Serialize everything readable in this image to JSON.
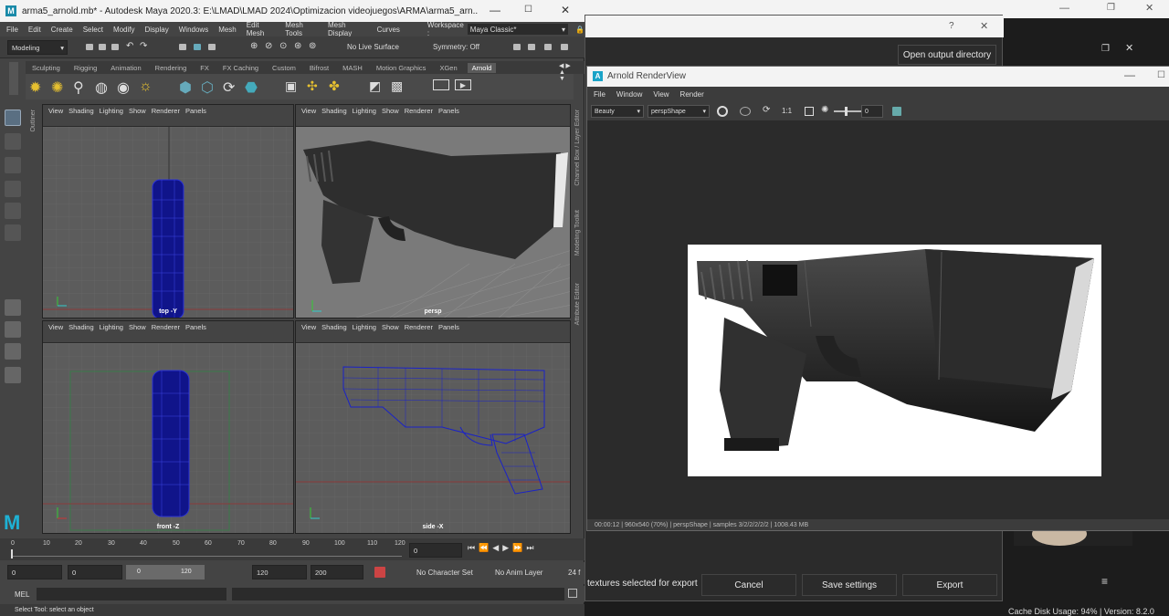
{
  "maya": {
    "title": "arma5_arnold.mb* - Autodesk Maya 2020.3: E:\\LMAD\\LMAD 2024\\Optimizacion videojuegos\\ARMA\\arma5_arn...",
    "menu": [
      "File",
      "Edit",
      "Create",
      "Select",
      "Modify",
      "Display",
      "Windows",
      "Mesh",
      "Edit Mesh",
      "Mesh Tools",
      "Mesh Display",
      "Curves"
    ],
    "workspace_label": "Workspace :",
    "workspace_value": "Maya Classic*",
    "menuset": "Modeling",
    "live_surface": "No Live Surface",
    "symmetry": "Symmetry: Off",
    "shelf_tabs": [
      "Sculpting",
      "Rigging",
      "Animation",
      "Rendering",
      "FX",
      "FX Caching",
      "Custom",
      "Bifrost",
      "MASH",
      "Motion Graphics",
      "XGen",
      "Arnold"
    ],
    "active_shelf": "Arnold",
    "viewports": [
      {
        "menu": [
          "View",
          "Shading",
          "Lighting",
          "Show",
          "Renderer",
          "Panels"
        ],
        "label": "top -Y"
      },
      {
        "menu": [
          "View",
          "Shading",
          "Lighting",
          "Show",
          "Renderer",
          "Panels"
        ],
        "label": "persp"
      },
      {
        "menu": [
          "View",
          "Shading",
          "Lighting",
          "Show",
          "Renderer",
          "Panels"
        ],
        "label": "front -Z"
      },
      {
        "menu": [
          "View",
          "Shading",
          "Lighting",
          "Show",
          "Renderer",
          "Panels"
        ],
        "label": "side -X"
      }
    ],
    "side_labels": [
      "Outliner",
      "Channel Box / Layer Editor",
      "Modeling Toolkit",
      "Attribute Editor"
    ],
    "timeline_ticks": [
      "0",
      "10",
      "20",
      "30",
      "40",
      "50",
      "60",
      "70",
      "80",
      "90",
      "100",
      "110",
      "120"
    ],
    "current_frame": "0",
    "range": {
      "start": "0",
      "start2": "0",
      "slider_start": "0",
      "slider_end": "120",
      "end": "120",
      "end2": "200"
    },
    "character_set": "No Character Set",
    "anim_layer": "No Anim Layer",
    "fps": "24 f",
    "mel_label": "MEL",
    "help": "Select Tool: select an object"
  },
  "render_view": {
    "title": "Arnold RenderView",
    "menu": [
      "File",
      "Window",
      "View",
      "Render"
    ],
    "aov": "Beauty",
    "camera": "perspShape",
    "ratio": "1:1",
    "exposure": "0",
    "status": "00:00:12 | 960x540 (70%) | perspShape | samples 3/2/2/2/2/2 | 1008.43 MB"
  },
  "background": {
    "help_glyph": "?",
    "close_glyph": "✕",
    "open_output": "Open output directory",
    "textures_text": "textures selected for export",
    "cancel": "Cancel",
    "save_settings": "Save settings",
    "export": "Export",
    "footer": "Cache Disk Usage:  94%  |  Version: 8.2.0"
  }
}
